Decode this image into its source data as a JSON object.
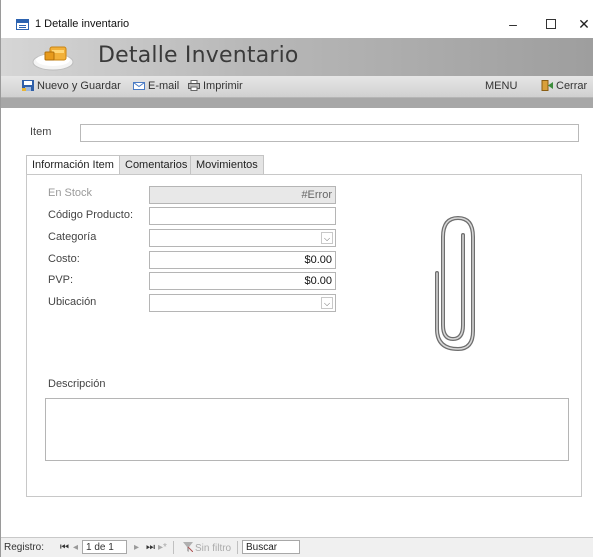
{
  "window": {
    "title": "1 Detalle inventario",
    "controls": {
      "minimize": "–",
      "close": "✕"
    }
  },
  "header": {
    "form_title": "Detalle Inventario"
  },
  "toolbar": {
    "save_label": "Nuevo y Guardar",
    "email_label": "E-mail",
    "print_label": "Imprimir",
    "menu_label": "MENU",
    "close_label": "Cerrar"
  },
  "item": {
    "label": "Item",
    "value": ""
  },
  "tabs": [
    {
      "label": "Información Item",
      "active": true
    },
    {
      "label": "Comentarios",
      "active": false
    },
    {
      "label": "Movimientos",
      "active": false
    }
  ],
  "fields": {
    "stock": {
      "label": "En Stock",
      "value": "#Error"
    },
    "product_code": {
      "label": "Código Producto:",
      "value": ""
    },
    "category": {
      "label": "Categoría",
      "value": ""
    },
    "cost": {
      "label": "Costo:",
      "value": "$0.00"
    },
    "price": {
      "label": "PVP:",
      "value": "$0.00"
    },
    "location": {
      "label": "Ubicación",
      "value": ""
    },
    "description": {
      "label": "Descripción",
      "value": ""
    }
  },
  "attachment_icon": "paperclip-icon",
  "statusbar": {
    "record_label": "Registro:",
    "first": "⏮",
    "prev": "◂",
    "record_value": "1 de 1",
    "next": "▸",
    "last": "⏭",
    "new": "▸*",
    "filter_label": "Sin filtro",
    "search_label": "Buscar"
  },
  "colors": {
    "header_gradient_start": "#d6d6d6",
    "header_gradient_end": "#9e9e9e",
    "error_text": "#666666"
  }
}
